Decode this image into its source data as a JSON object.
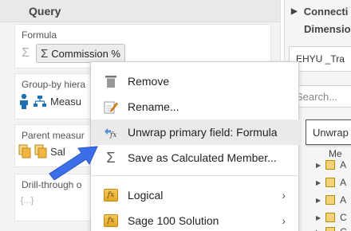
{
  "query_panel": {
    "header": "Query",
    "formula": {
      "label": "Formula",
      "chip": "Commission %"
    },
    "group_by": {
      "label": "Group-by hiera",
      "field": "Measu"
    },
    "parent_measure": {
      "label": "Parent measur",
      "field": "Sal"
    },
    "drill_through": {
      "label": "Drill-through o",
      "value": "{...}"
    }
  },
  "right_panel": {
    "connection": "Connecti",
    "dimensions": "Dimensio",
    "connection_name": "EHYU _Tra",
    "search_placeholder": "Search...",
    "tooltip": "Unwrap",
    "tree_items": [
      "Me",
      "A",
      "A",
      "A",
      "C",
      "C"
    ]
  },
  "context_menu": {
    "items": [
      {
        "label": "Remove",
        "icon": "trash-icon"
      },
      {
        "label": "Rename...",
        "icon": "pencil-icon"
      },
      {
        "label": "Unwrap primary field: Formula",
        "icon": "unwrap-formula-icon"
      },
      {
        "label": "Save as Calculated Member...",
        "icon": "sigma-icon"
      },
      {
        "label": "Logical",
        "icon": "fx-icon",
        "submenu": true
      },
      {
        "label": "Sage 100 Solution",
        "icon": "fx-icon",
        "submenu": true
      }
    ],
    "fx_text": "fx",
    "chevron": "›"
  },
  "colors": {
    "cursor": "#3b6ee8",
    "fx_badge": "#e0a825",
    "accent_blue": "#1f6fb5"
  }
}
